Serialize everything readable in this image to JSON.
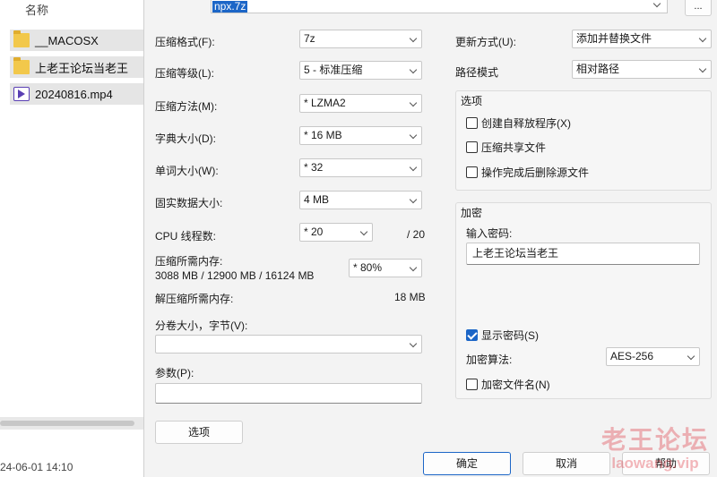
{
  "explorer": {
    "column_name": "名称",
    "files": [
      {
        "name": "__MACOSX",
        "icon": "folder-icon"
      },
      {
        "name": "上老王论坛当老王",
        "icon": "folder-icon"
      },
      {
        "name": "20240816.mp4",
        "icon": "video-file-icon"
      }
    ],
    "status_date": "24-06-01 14:10"
  },
  "dialog": {
    "archive_path": "npx.7z",
    "browse_label": "...",
    "left": {
      "format_label": "压缩格式(F):",
      "format_value": "7z",
      "level_label": "压缩等级(L):",
      "level_value": "5 - 标准压缩",
      "method_label": "压缩方法(M):",
      "method_value": "* LZMA2",
      "dict_label": "字典大小(D):",
      "dict_value": "* 16 MB",
      "word_label": "单词大小(W):",
      "word_value": "* 32",
      "solid_label": "固实数据大小:",
      "solid_value": "4 MB",
      "threads_label": "CPU 线程数:",
      "threads_value": "* 20",
      "threads_max": "/ 20",
      "mem_compress_label": "压缩所需内存:",
      "mem_compress_detail": "3088 MB / 12900 MB / 16124 MB",
      "mem_percent_value": "* 80%",
      "mem_decompress_label": "解压缩所需内存:",
      "mem_decompress_value": "18 MB",
      "volume_label": "分卷大小，字节(V):",
      "volume_value": "",
      "params_label": "参数(P):",
      "params_value": "",
      "options_button": "选项"
    },
    "right": {
      "update_label": "更新方式(U):",
      "update_value": "添加并替换文件",
      "pathmode_label": "路径模式",
      "pathmode_value": "相对路径",
      "options_group": "选项",
      "opt_sfx": "创建自释放程序(X)",
      "opt_shared": "压缩共享文件",
      "opt_delete": "操作完成后删除源文件",
      "encrypt_group": "加密",
      "password_label": "输入密码:",
      "password_value": "上老王论坛当老王",
      "show_password": "显示密码(S)",
      "show_password_checked": true,
      "enc_method_label": "加密算法:",
      "enc_method_value": "AES-256",
      "encrypt_names": "加密文件名(N)"
    },
    "buttons": {
      "ok": "确定",
      "cancel": "取消",
      "help": "帮助"
    }
  },
  "watermark": {
    "line1": "老王论坛",
    "line2": "laowang.vip"
  },
  "colors": {
    "accent": "#1c66c7",
    "folder": "#f2c84b",
    "watermark": "#dc323c"
  }
}
